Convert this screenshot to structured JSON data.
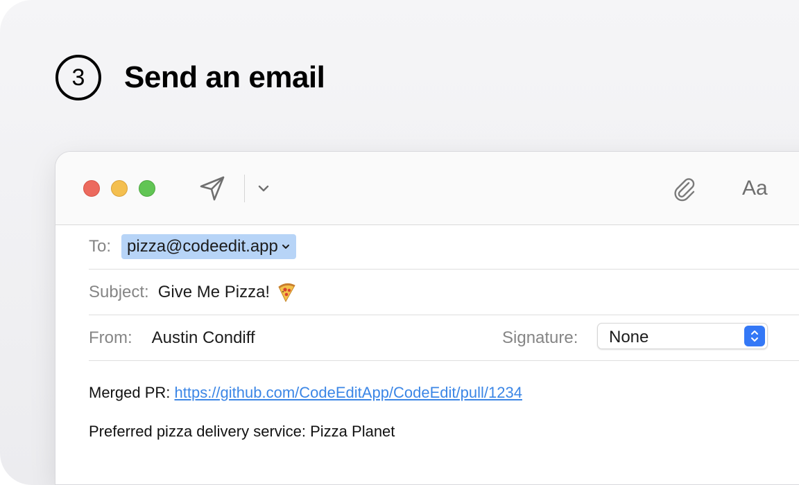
{
  "step": {
    "number": "3",
    "title": "Send an email"
  },
  "toolbar": {
    "traffic_lights": [
      "close",
      "minimize",
      "zoom"
    ],
    "send_icon": "paper-plane-icon",
    "dropdown_icon": "chevron-down-icon",
    "attach_icon": "paperclip-icon",
    "format_label": "Aa"
  },
  "email": {
    "to_label": "To:",
    "to_value": "pizza@codeedit.app",
    "subject_label": "Subject:",
    "subject_value": "Give Me Pizza!",
    "subject_emoji": "pizza-icon",
    "from_label": "From:",
    "from_value": "Austin Condiff",
    "signature_label": "Signature:",
    "signature_value": "None"
  },
  "body": {
    "line1_label": "Merged PR:",
    "line1_link": "https://github.com/CodeEditApp/CodeEdit/pull/1234",
    "line2": "Preferred pizza delivery service: Pizza Planet"
  },
  "colors": {
    "close": "#ec6a5e",
    "minimize": "#f4bf4f",
    "zoom": "#61c554",
    "token_bg": "#b7d4f7",
    "link": "#3b86e6",
    "stepper": "#3478f6"
  }
}
